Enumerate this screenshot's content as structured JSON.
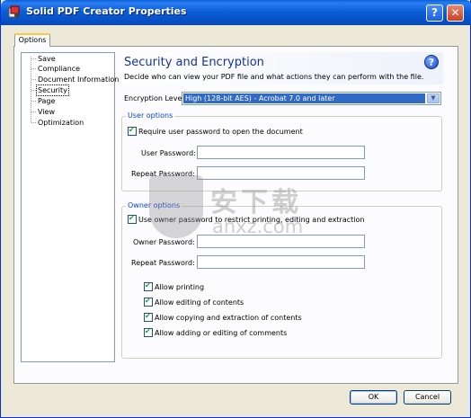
{
  "window": {
    "title": "Solid PDF Creator Properties",
    "help_glyph": "?",
    "close_glyph": "✕"
  },
  "tabs": [
    {
      "label": "Options"
    }
  ],
  "tree": {
    "items": [
      {
        "label": "Save"
      },
      {
        "label": "Compliance"
      },
      {
        "label": "Document Information"
      },
      {
        "label": "Security"
      },
      {
        "label": "Page"
      },
      {
        "label": "View"
      },
      {
        "label": "Optimization"
      }
    ],
    "selected": "Security"
  },
  "panel": {
    "title": "Security and Encryption",
    "description": "Decide who can view your PDF file and what actions they can perform with the file.",
    "help_glyph": "?"
  },
  "encryption": {
    "label": "Encryption Level:",
    "value": "High (128-bit AES) - Acrobat 7.0 and later"
  },
  "user_options": {
    "legend": "User options",
    "require_password_label": "Require user password to open the document",
    "require_password_checked": true,
    "user_password_label": "User Password:",
    "user_password_value": "",
    "repeat_password_label": "Repeat Password:",
    "repeat_password_value": ""
  },
  "owner_options": {
    "legend": "Owner options",
    "use_owner_password_label": "Use owner password to restrict printing, editing and extraction",
    "use_owner_password_checked": true,
    "owner_password_label": "Owner Password:",
    "owner_password_value": "",
    "repeat_password_label": "Repeat Password:",
    "repeat_password_value": "",
    "permissions": [
      {
        "label": "Allow printing",
        "checked": true
      },
      {
        "label": "Allow editing of contents",
        "checked": true
      },
      {
        "label": "Allow copying and extraction of contents",
        "checked": true
      },
      {
        "label": "Allow adding or editing of comments",
        "checked": true
      }
    ]
  },
  "buttons": {
    "ok": "OK",
    "cancel": "Cancel"
  },
  "watermark": {
    "text": "安下载",
    "sub": "anxz.com"
  },
  "colors": {
    "title_bar": "#0b5ed5",
    "selection": "#316ac5",
    "legend_text": "#0046d5",
    "checkmark": "#21a121"
  }
}
